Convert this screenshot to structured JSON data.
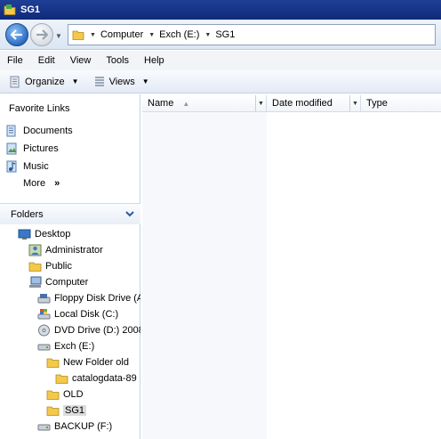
{
  "window": {
    "title": "SG1"
  },
  "address": {
    "crumbs": [
      "Computer",
      "Exch (E:)",
      "SG1"
    ]
  },
  "menu": [
    "File",
    "Edit",
    "View",
    "Tools",
    "Help"
  ],
  "toolbar": {
    "organize": "Organize",
    "views": "Views"
  },
  "favorites": {
    "header": "Favorite Links",
    "items": [
      {
        "label": "Documents",
        "icon": "documents-icon"
      },
      {
        "label": "Pictures",
        "icon": "pictures-icon"
      },
      {
        "label": "Music",
        "icon": "music-icon"
      },
      {
        "label": "More",
        "icon": ""
      }
    ],
    "more_glyph": "»"
  },
  "folders": {
    "header": "Folders",
    "tree": [
      {
        "label": "Desktop",
        "icon": "desktop-icon"
      },
      {
        "label": "Administrator",
        "icon": "user-folder-icon"
      },
      {
        "label": "Public",
        "icon": "folder-icon"
      },
      {
        "label": "Computer",
        "icon": "computer-icon"
      },
      {
        "label": "Floppy Disk Drive (A",
        "icon": "floppy-drive-icon"
      },
      {
        "label": "Local Disk (C:)",
        "icon": "local-disk-icon"
      },
      {
        "label": "DVD Drive (D:) 2008",
        "icon": "dvd-drive-icon"
      },
      {
        "label": "Exch (E:)",
        "icon": "drive-icon"
      },
      {
        "label": "New Folder old",
        "icon": "folder-icon"
      },
      {
        "label": "catalogdata-89",
        "icon": "folder-icon"
      },
      {
        "label": "OLD",
        "icon": "folder-icon"
      },
      {
        "label": "SG1",
        "icon": "folder-icon",
        "selected": true
      },
      {
        "label": "BACKUP (F:)",
        "icon": "drive-icon"
      }
    ]
  },
  "columns": {
    "name": "Name",
    "date_modified": "Date modified",
    "type": "Type"
  },
  "colors": {
    "titlebar": "#1f3f96",
    "folder": "#f2c94c",
    "selection": "#dcdcdc"
  }
}
